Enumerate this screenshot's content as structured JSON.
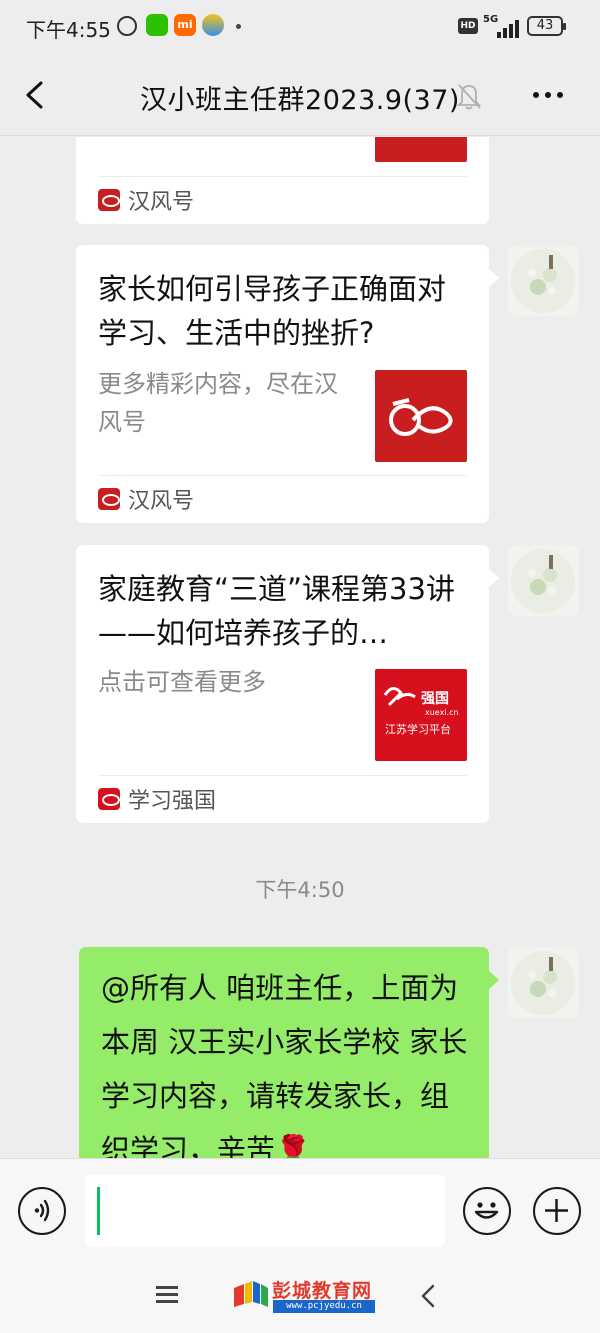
{
  "status_bar": {
    "time": "下午4:55",
    "network": "5G",
    "hd": "HD",
    "mi": "mi",
    "battery": "43"
  },
  "header": {
    "title": "汉小班主任群2023.9(37)"
  },
  "messages": [
    {
      "type": "article",
      "source": "汉风号"
    },
    {
      "type": "article",
      "title": "家长如何引导孩子正确面对学习、生活中的挫折?",
      "desc": "更多精彩内容，尽在汉风号",
      "source": "汉风号",
      "thumb": "han-feng-logo"
    },
    {
      "type": "article",
      "title": "家庭教育“三道”课程第33讲——如何培养孩子的…",
      "desc": "点击可查看更多",
      "source": "学习强国",
      "thumb": "xuexi-qiangguo-logo",
      "thumb_text_1": "强国",
      "thumb_text_2": "xuexi.cn",
      "thumb_text_3": "江苏学习平台"
    }
  ],
  "timestamp": "下午4:50",
  "text_message": {
    "text": "@所有人  咱班主任，上面为本周 汉王实小家长学校 家长学习内容，请转发家长，组织学习，辛苦🌹"
  },
  "watermark": {
    "title": "彭城教育网",
    "url": "www.pcjyedu.cn"
  },
  "colors": {
    "bubble_green": "#95ec69",
    "brand_red": "#c91e20",
    "caret_green": "#07c160"
  }
}
